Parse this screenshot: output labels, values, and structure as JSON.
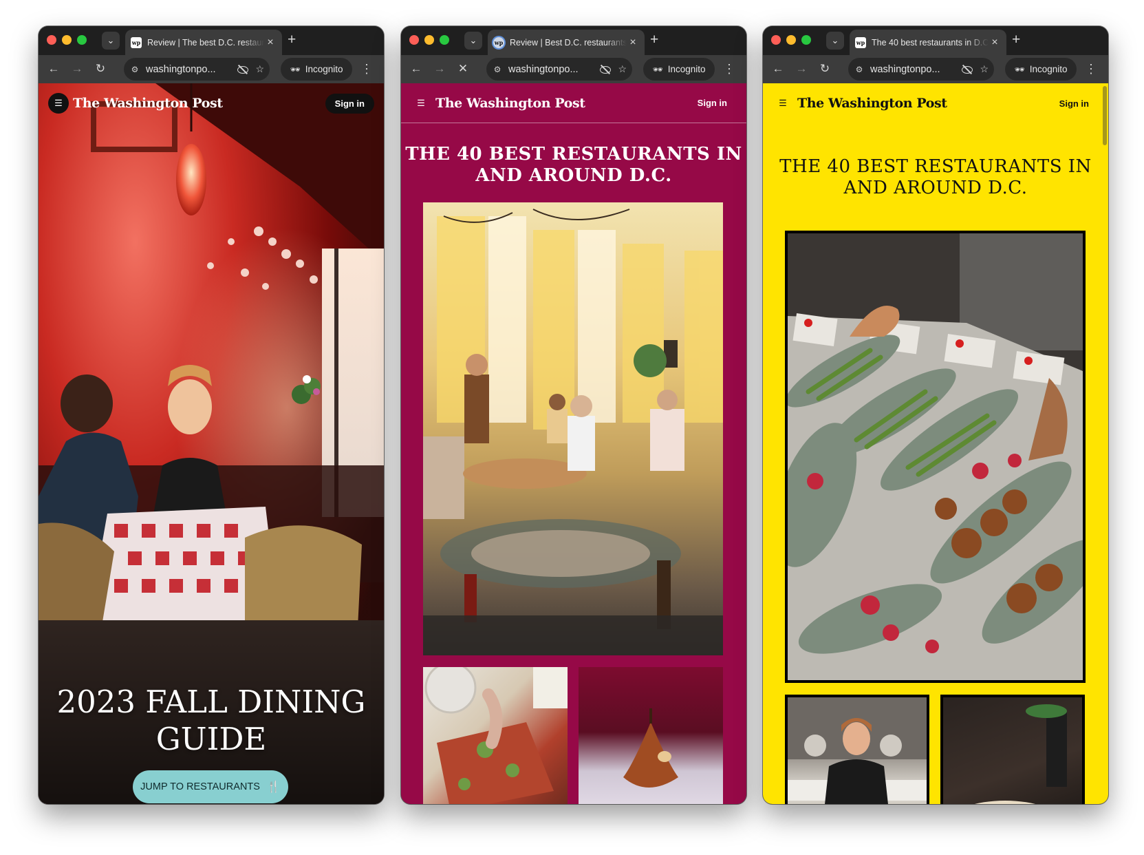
{
  "windows": [
    {
      "tab_title": "Review | The best D.C. restaurants",
      "favicon": "wp",
      "url": "washingtonpo...",
      "incognito_label": "Incognito",
      "reload_icon": "reload-icon",
      "page": {
        "theme": "red-photo",
        "logo": "The Washington Post",
        "sign_in": "Sign in",
        "hero_title": "2023 FALL DINING GUIDE",
        "cta": "JUMP TO RESTAURANTS",
        "cta_icon": "cutlery-icon"
      }
    },
    {
      "tab_title": "Review | Best D.C. restaurants",
      "favicon": "wp",
      "url": "washingtonpo...",
      "incognito_label": "Incognito",
      "reload_icon": "stop-loading-icon",
      "page": {
        "theme": "#960947",
        "logo": "The Washington Post",
        "sign_in": "Sign in",
        "title": "THE 40 BEST RESTAURANTS IN AND AROUND D.C."
      }
    },
    {
      "tab_title": "The 40 best restaurants in D.C.",
      "favicon": "wp",
      "url": "washingtonpo...",
      "incognito_label": "Incognito",
      "reload_icon": "reload-icon",
      "page": {
        "theme": "#ffe400",
        "logo": "The Washington Post",
        "sign_in": "Sign in",
        "title": "THE 40 BEST RESTAURANTS IN AND AROUND D.C."
      }
    }
  ],
  "colors": {
    "chrome_dark": "#1f1f1f",
    "toolbar": "#3c3c3c",
    "cta_teal": "#88cfd0",
    "magenta": "#960947",
    "yellow": "#ffe400"
  }
}
